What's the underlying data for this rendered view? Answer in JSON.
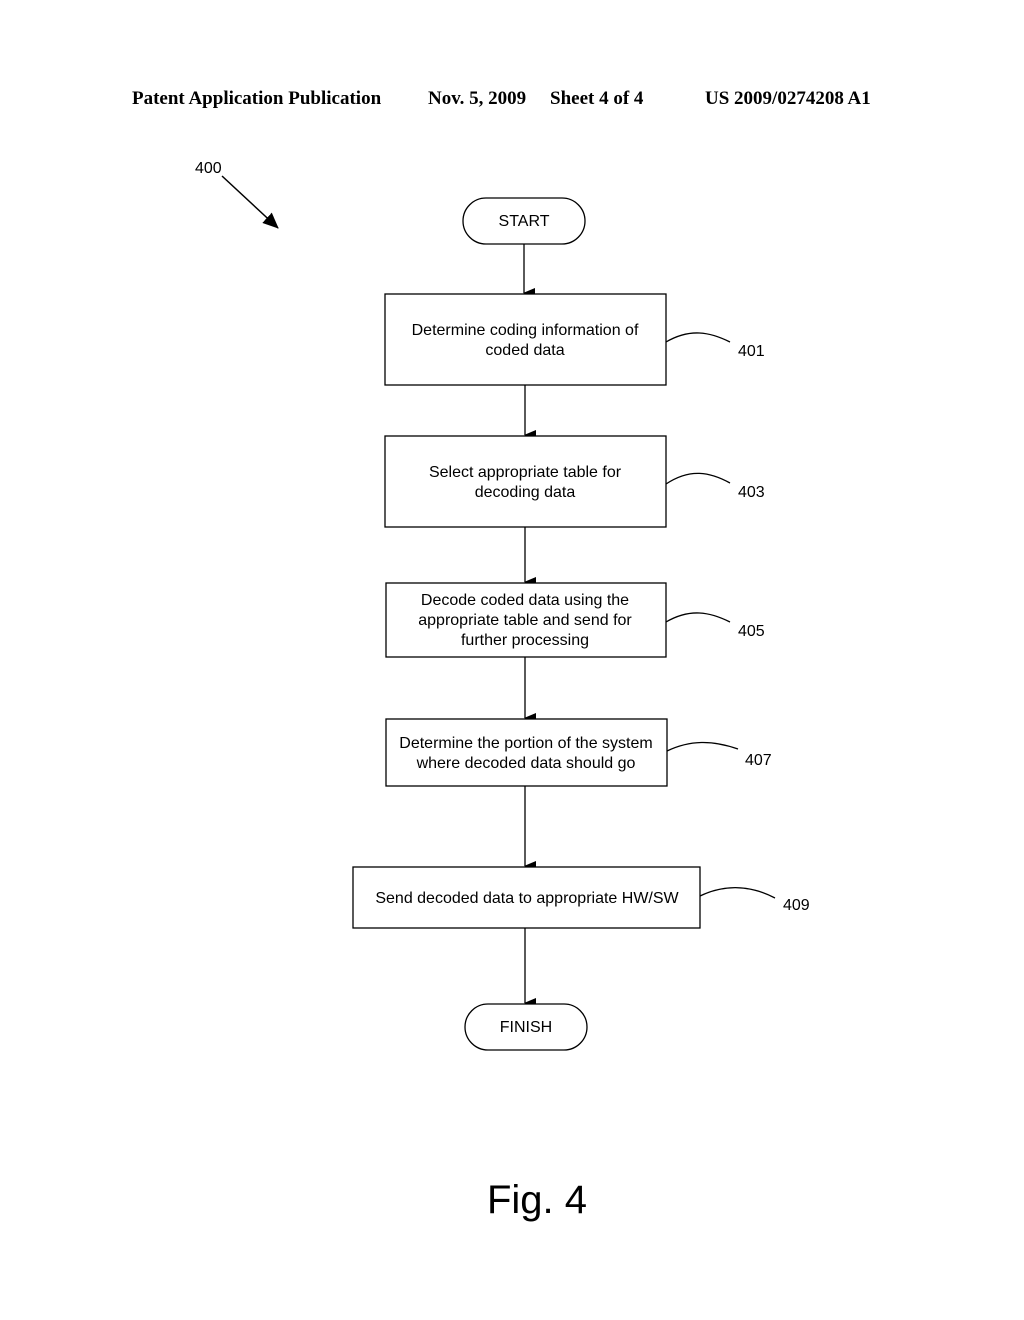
{
  "header": {
    "publication": "Patent Application Publication",
    "date": "Nov. 5, 2009",
    "sheet": "Sheet 4 of 4",
    "patent_number": "US 2009/0274208 A1"
  },
  "figure": {
    "ref": "400",
    "caption": "Fig. 4"
  },
  "flowchart": {
    "start": "START",
    "finish": "FINISH",
    "steps": [
      {
        "ref": "401",
        "lines": [
          "Determine coding information of",
          "coded data"
        ]
      },
      {
        "ref": "403",
        "lines": [
          "Select appropriate table for",
          "decoding data"
        ]
      },
      {
        "ref": "405",
        "lines": [
          "Decode coded data using the",
          "appropriate table and send for",
          "further processing"
        ]
      },
      {
        "ref": "407",
        "lines": [
          "Determine the portion of the system",
          "where decoded data should go"
        ]
      },
      {
        "ref": "409",
        "lines": [
          "Send decoded data to appropriate HW/SW"
        ]
      }
    ]
  }
}
